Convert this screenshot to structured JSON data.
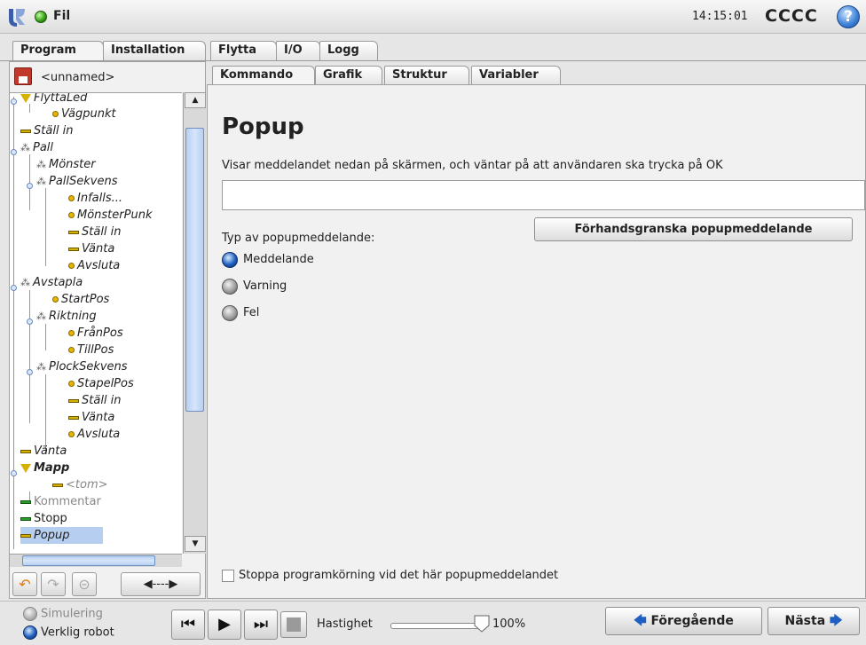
{
  "topbar": {
    "file_label": "Fil",
    "time": "14:15:01",
    "robot_name": "CCCC",
    "help_symbol": "?"
  },
  "main_tabs": [
    {
      "label": "Program",
      "active": true
    },
    {
      "label": "Installation",
      "active": false
    },
    {
      "label": "Flytta",
      "active": false
    },
    {
      "label": "I/O",
      "active": false
    },
    {
      "label": "Logg",
      "active": false
    }
  ],
  "program": {
    "name": "<unnamed>"
  },
  "tree": [
    {
      "label": "FlyttaLed",
      "icon": "move-icon"
    },
    {
      "label": "Vägpunkt",
      "icon": "waypoint-icon"
    },
    {
      "label": "Ställ in",
      "icon": "set-icon"
    },
    {
      "label": "Pall",
      "icon": "pallet-icon"
    },
    {
      "label": "Mönster",
      "icon": "pallet-icon"
    },
    {
      "label": "PallSekvens",
      "icon": "pallet-icon"
    },
    {
      "label": "Infalls...",
      "icon": "waypoint-icon"
    },
    {
      "label": "MönsterPunk",
      "icon": "waypoint-icon"
    },
    {
      "label": "Ställ in",
      "icon": "set-icon"
    },
    {
      "label": "Vänta",
      "icon": "wait-icon"
    },
    {
      "label": "Avsluta",
      "icon": "waypoint-icon"
    },
    {
      "label": "Avstapla",
      "icon": "pallet-icon"
    },
    {
      "label": "StartPos",
      "icon": "waypoint-icon"
    },
    {
      "label": "Riktning",
      "icon": "pallet-icon"
    },
    {
      "label": "FrånPos",
      "icon": "waypoint-icon"
    },
    {
      "label": "TillPos",
      "icon": "waypoint-icon"
    },
    {
      "label": "PlockSekvens",
      "icon": "pallet-icon"
    },
    {
      "label": "StapelPos",
      "icon": "waypoint-icon"
    },
    {
      "label": "Ställ in",
      "icon": "set-icon"
    },
    {
      "label": "Vänta",
      "icon": "wait-icon"
    },
    {
      "label": "Avsluta",
      "icon": "waypoint-icon"
    },
    {
      "label": "Vänta",
      "icon": "wait-icon"
    },
    {
      "label": "Mapp",
      "icon": "folder-icon"
    },
    {
      "label": "<tom>",
      "icon": "empty-icon"
    },
    {
      "label": "Kommentar",
      "icon": "comment-icon"
    },
    {
      "label": "Stopp",
      "icon": "stop-icon"
    },
    {
      "label": "Popup",
      "icon": "popup-icon",
      "selected": true
    }
  ],
  "cmd_tabs": [
    {
      "label": "Kommando",
      "active": true
    },
    {
      "label": "Grafik",
      "active": false
    },
    {
      "label": "Struktur",
      "active": false
    },
    {
      "label": "Variabler",
      "active": false
    }
  ],
  "command": {
    "title": "Popup",
    "description": "Visar meddelandet nedan på skärmen, och väntar på att användaren ska trycka på OK",
    "message_value": "",
    "preview_button": "Förhandsgranska popupmeddelande",
    "type_label": "Typ av popupmeddelande:",
    "types": [
      {
        "label": "Meddelande",
        "selected": true
      },
      {
        "label": "Varning",
        "selected": false
      },
      {
        "label": "Fel",
        "selected": false
      }
    ],
    "stop_checkbox_label": "Stoppa programkörning vid det här popupmeddelandet",
    "stop_checked": false
  },
  "bottom": {
    "simulation_label": "Simulering",
    "real_robot_label": "Verklig robot",
    "speed_label": "Hastighet",
    "speed_value": "100%",
    "speed_fraction": 1.0,
    "prev_label": "Föregående",
    "next_label": "Nästa"
  }
}
